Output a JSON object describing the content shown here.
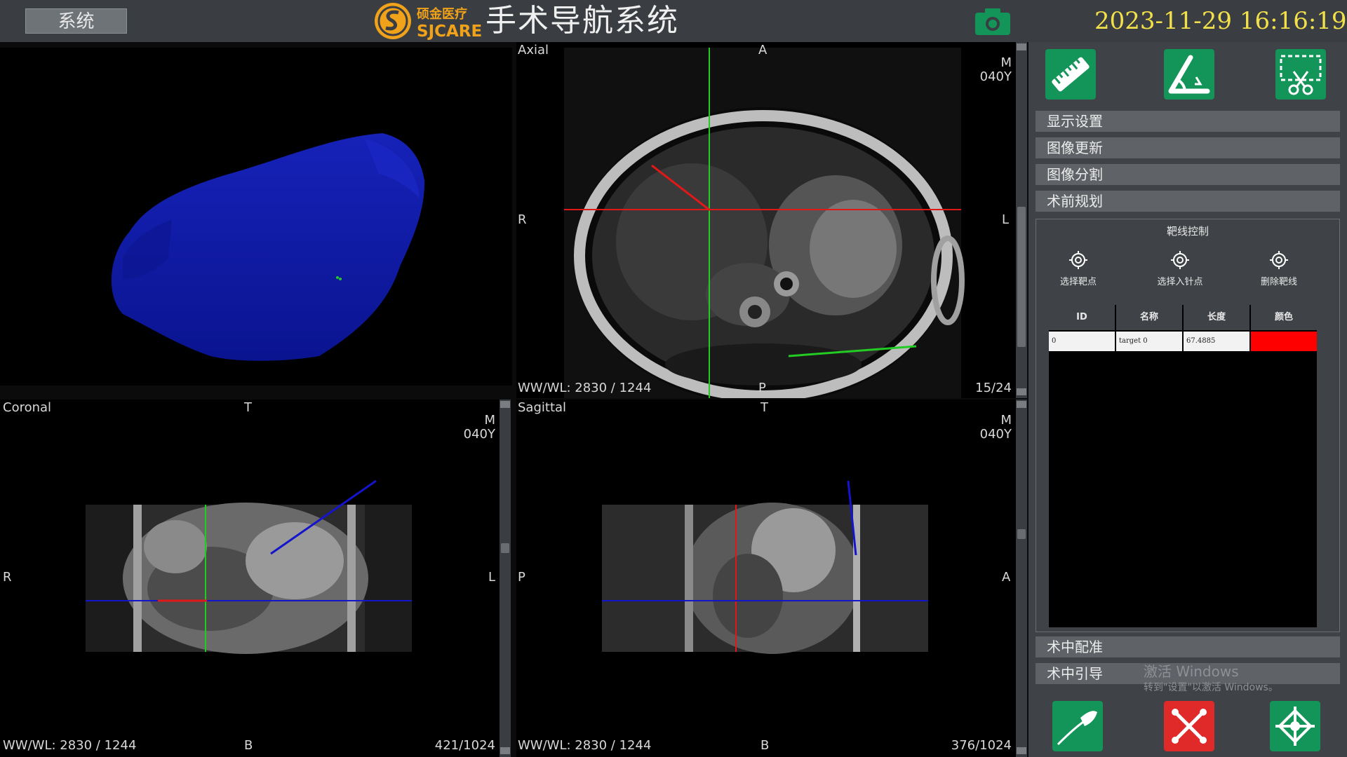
{
  "header": {
    "system_button": "系统",
    "logo_cn": "硕金医疗",
    "logo_en": "SJCARE",
    "title": "手术导航系统",
    "datetime": "2023-11-29  16:16:19"
  },
  "views": {
    "axial": {
      "name": "Axial",
      "top": "A",
      "bottom": "P",
      "left": "R",
      "right": "L",
      "corner_m": "M",
      "corner_age": "040Y",
      "wwwl": "WW/WL: 2830 / 1244",
      "slice": "15/24"
    },
    "coronal": {
      "name": "Coronal",
      "top": "T",
      "bottom": "B",
      "left": "R",
      "right": "L",
      "corner_m": "M",
      "corner_age": "040Y",
      "wwwl": "WW/WL: 2830 / 1244",
      "slice": "421/1024"
    },
    "sagittal": {
      "name": "Sagittal",
      "top": "T",
      "bottom": "B",
      "left": "P",
      "right": "A",
      "corner_m": "M",
      "corner_age": "040Y",
      "wwwl": "WW/WL: 2830 / 1244",
      "slice": "376/1024"
    }
  },
  "panel": {
    "menus": [
      "显示设置",
      "图像更新",
      "图像分割",
      "术前规划"
    ],
    "target_control": {
      "title": "靶线控制",
      "buttons": [
        "选择靶点",
        "选择入针点",
        "删除靶线"
      ],
      "table": {
        "columns": [
          "ID",
          "名称",
          "长度",
          "颜色"
        ],
        "rows": [
          {
            "id": "0",
            "name": "target 0",
            "length": "67.4885",
            "color": "#ff0000"
          }
        ]
      }
    },
    "menus_bottom": [
      "术中配准",
      "术中引导"
    ],
    "watermark": {
      "line1": "激活 Windows",
      "line2": "转到\"设置\"以激活 Windows。"
    }
  },
  "colors": {
    "tool_green": "#13955a",
    "danger_red": "#e02a2a",
    "crosshair_green": "#22cc22",
    "crosshair_red": "#e01818",
    "crosshair_blue": "#1414cc",
    "mesh_blue": "#0f1aa8",
    "clock_yellow": "#f2e04a"
  },
  "icons": {
    "camera": "camera-icon",
    "ruler": "ruler-icon",
    "angle": "angle-measure-icon",
    "crop": "scissors-crop-icon",
    "probe": "probe-icon",
    "close": "close-x-icon",
    "network": "tracking-network-icon",
    "target": "crosshair-target-icon"
  }
}
